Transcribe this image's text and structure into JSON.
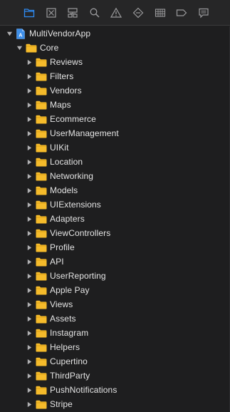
{
  "toolbar": {
    "icons": [
      {
        "name": "project-navigator-icon",
        "active": true
      },
      {
        "name": "source-control-navigator-icon",
        "active": false
      },
      {
        "name": "symbol-navigator-icon",
        "active": false
      },
      {
        "name": "find-navigator-icon",
        "active": false
      },
      {
        "name": "issue-navigator-icon",
        "active": false
      },
      {
        "name": "test-navigator-icon",
        "active": false
      },
      {
        "name": "debug-navigator-icon",
        "active": false
      },
      {
        "name": "breakpoint-navigator-icon",
        "active": false
      },
      {
        "name": "report-navigator-icon",
        "active": false
      }
    ],
    "active_color": "#2f8cf4",
    "inactive_color": "#9a9a9c"
  },
  "tree": {
    "project": {
      "label": "MultiVendorApp",
      "expanded": true
    },
    "group": {
      "label": "Core",
      "expanded": true
    },
    "folders": [
      "Reviews",
      "Filters",
      "Vendors",
      "Maps",
      "Ecommerce",
      "UserManagement",
      "UIKit",
      "Location",
      "Networking",
      "Models",
      "UIExtensions",
      "Adapters",
      "ViewControllers",
      "Profile",
      "API",
      "UserReporting",
      "Apple Pay",
      "Views",
      "Assets",
      "Instagram",
      "Helpers",
      "Cupertino",
      "ThirdParty",
      "PushNotifications",
      "Stripe"
    ],
    "folder_color": "#f5bb2b"
  }
}
